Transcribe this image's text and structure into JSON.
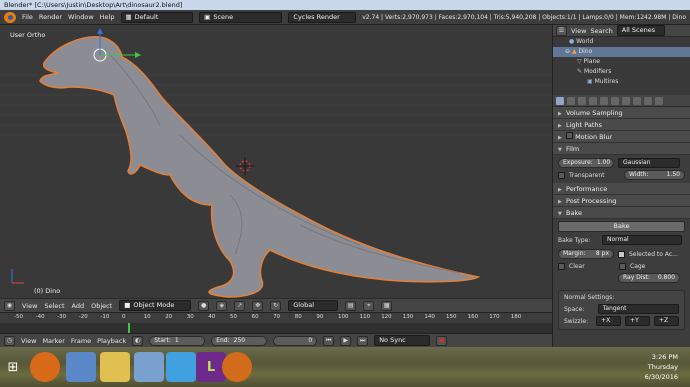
{
  "window": {
    "title": "Blender* [C:\\Users\\Justin\\Desktop\\Art\\dinosaur2.blend]"
  },
  "info_header": {
    "menus": [
      "File",
      "Render",
      "Window",
      "Help"
    ],
    "screen_layout": "Default",
    "scene": "Scene",
    "render_engine": "Cycles Render",
    "stats": "v2.74 | Verts:2,970,973 | Faces:2,970,104 | Tris:5,940,208 | Objects:1/1 | Lamps:0/0 | Mem:1242.98M | Dino"
  },
  "viewport": {
    "view_label": "User Ortho",
    "object_label": "(0) Dino"
  },
  "view3d_header": {
    "menus": [
      "View",
      "Select",
      "Add",
      "Object"
    ],
    "mode": "Object Mode",
    "orientation": "Global"
  },
  "timeline": {
    "ticks": [
      "-50",
      "-40",
      "-30",
      "-20",
      "-10",
      "0",
      "10",
      "20",
      "30",
      "40",
      "50",
      "60",
      "70",
      "80",
      "90",
      "100",
      "110",
      "120",
      "130",
      "140",
      "150",
      "160",
      "170",
      "180"
    ],
    "current_frame": "0",
    "start_label": "Start:",
    "start_value": "1",
    "end_label": "End:",
    "end_value": "250",
    "frame_value": "0",
    "sync": "No Sync",
    "menus": [
      "View",
      "Marker",
      "Frame",
      "Playback"
    ]
  },
  "outliner": {
    "header": {
      "view": "View",
      "search": "Search",
      "filter": "All Scenes"
    },
    "rows": [
      "World",
      "Dino",
      "Plane",
      "Modifiers",
      "Multires"
    ]
  },
  "properties": {
    "panels": {
      "volume_sampling": "Volume Sampling",
      "light_paths": "Light Paths",
      "motion_blur": "Motion Blur",
      "film": "Film",
      "performance": "Performance",
      "post_processing": "Post Processing",
      "bake": "Bake"
    },
    "film": {
      "exposure_label": "Exposure:",
      "exposure_value": "1.00",
      "filter": "Gaussian",
      "transparent": "Transparent",
      "width_label": "Width:",
      "width_value": "1.50"
    },
    "bake": {
      "button": "Bake",
      "bake_type_label": "Bake Type:",
      "bake_type": "Normal",
      "margin_label": "Margin:",
      "margin_value": "8 px",
      "selected_to_active": "Selected to Ac...",
      "clear": "Clear",
      "cage": "Cage",
      "ray_dist_label": "Ray Dist:",
      "ray_dist_value": "0.800",
      "normal_settings": "Normal Settings:",
      "space_label": "Space:",
      "space": "Tangent",
      "swizzle_label": "Swizzle:",
      "swizzle": [
        "+X",
        "+Y",
        "+Z"
      ]
    }
  },
  "taskbar": {
    "time": "3:26 PM",
    "day": "Thursday",
    "date": "6/30/2016"
  },
  "colors": {
    "accent": "#e87d0d",
    "selection": "#5f7794",
    "dino": "#8c8c95",
    "outline": "#e0803a"
  }
}
